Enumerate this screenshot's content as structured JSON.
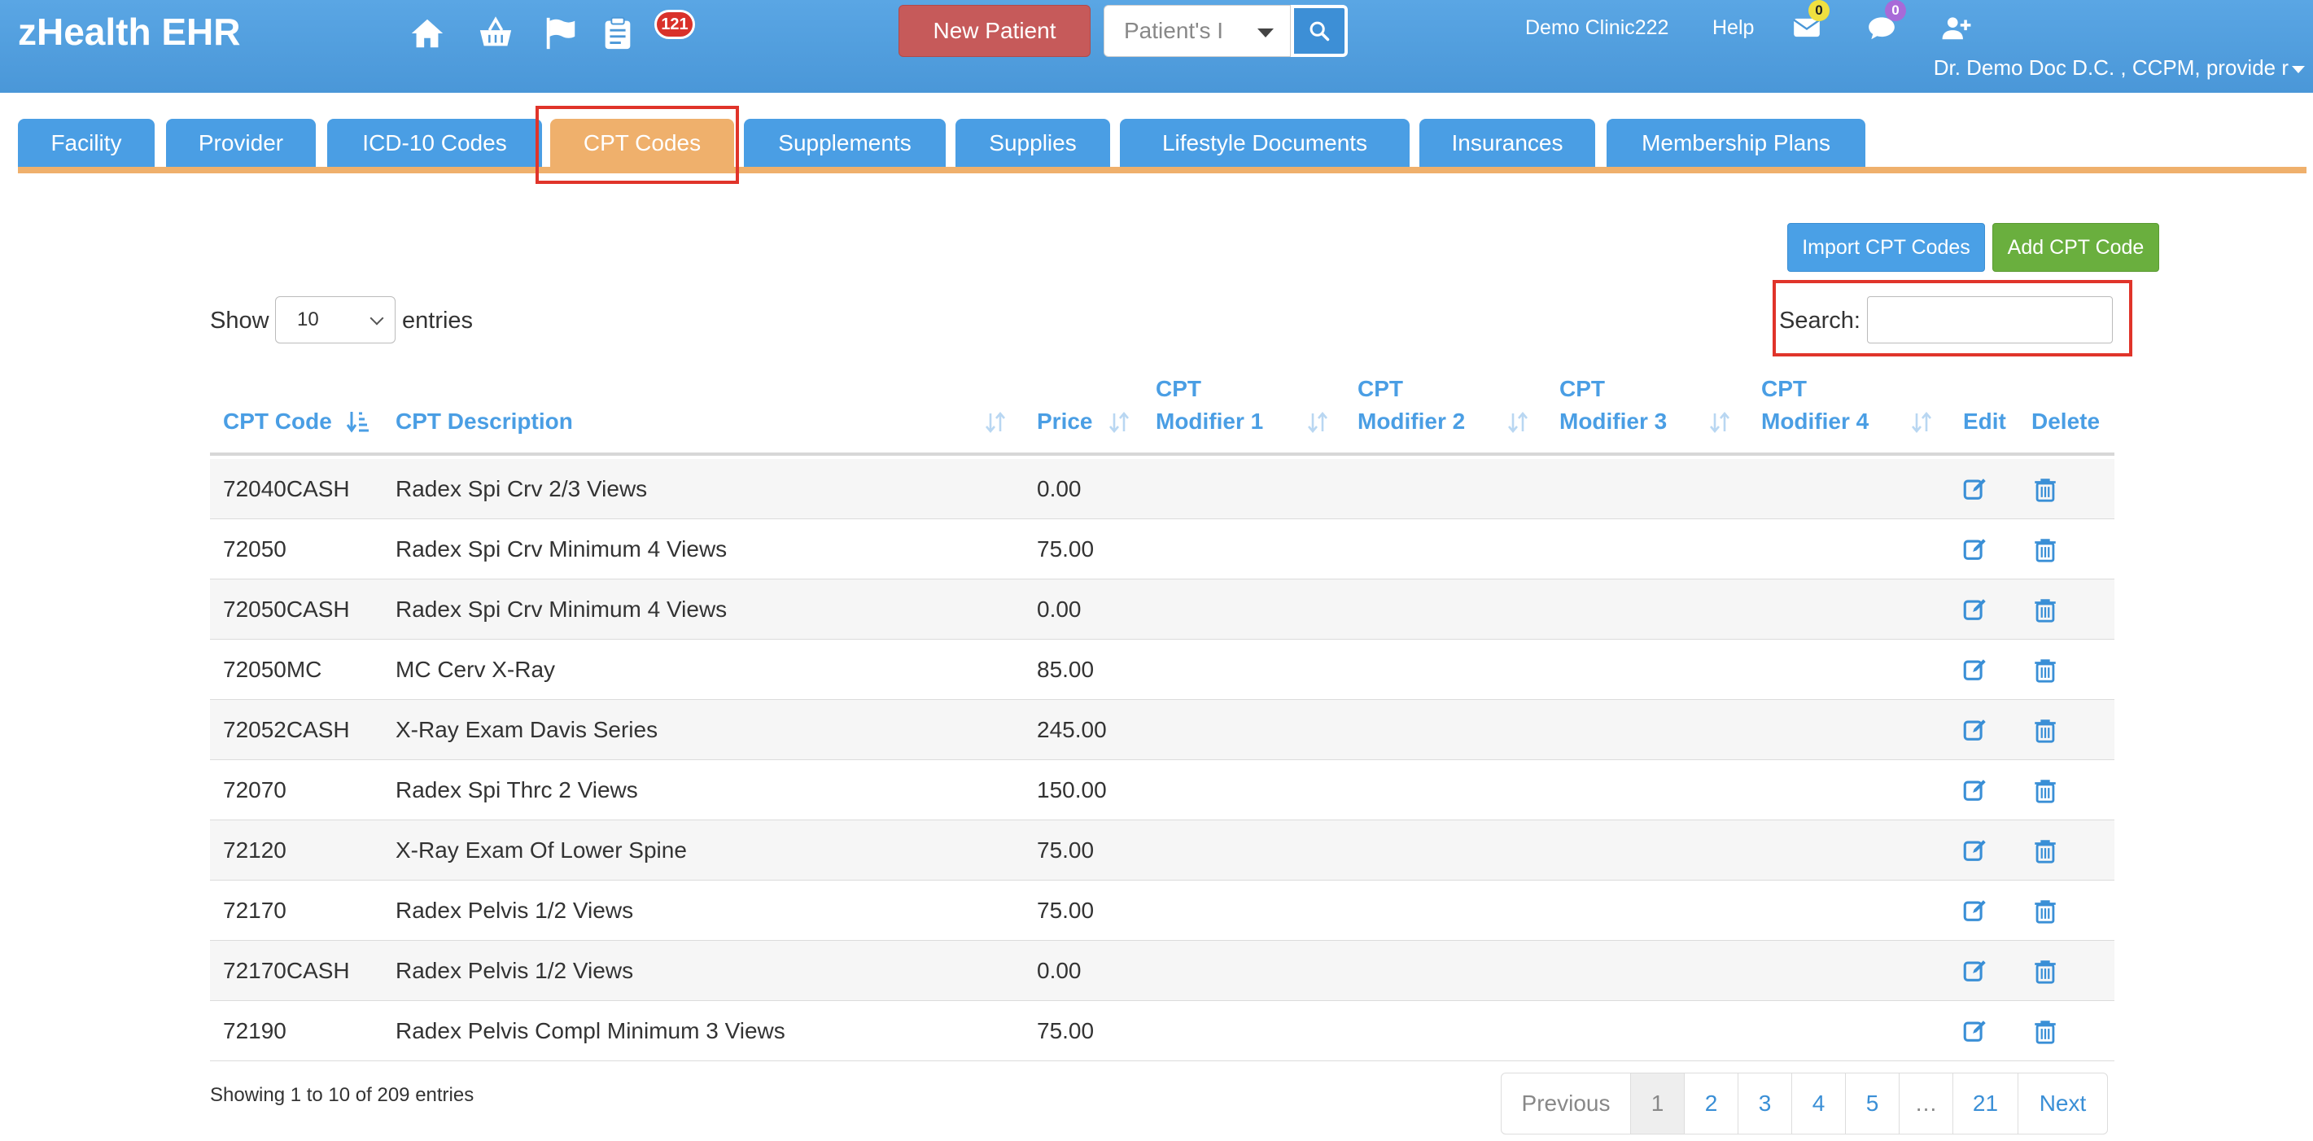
{
  "app": {
    "title": "zHealth EHR",
    "alert_count": "121",
    "new_patient_label": "New Patient",
    "patient_search_placeholder": "Patient's I",
    "clinic_name": "Demo Clinic222",
    "help_label": "Help",
    "mail_count": "0",
    "chat_count": "0",
    "user_name": "Dr. Demo Doc D.C. , CCPM, provide r"
  },
  "tabs": [
    {
      "label": "Facility"
    },
    {
      "label": "Provider"
    },
    {
      "label": "ICD-10 Codes"
    },
    {
      "label": "CPT Codes"
    },
    {
      "label": "Supplements"
    },
    {
      "label": "Supplies"
    },
    {
      "label": "Lifestyle Documents"
    },
    {
      "label": "Insurances"
    },
    {
      "label": "Membership Plans"
    }
  ],
  "toolbar": {
    "import_label": "Import CPT Codes",
    "add_label": "Add CPT Code",
    "show_label": "Show",
    "entries_value": "10",
    "entries_label": "entries",
    "search_label": "Search:",
    "search_value": ""
  },
  "table": {
    "headers": {
      "code": "CPT Code",
      "description": "CPT Description",
      "price": "Price",
      "mod1_a": "CPT",
      "mod1_b": "Modifier 1",
      "mod2_a": "CPT",
      "mod2_b": "Modifier 2",
      "mod3_a": "CPT",
      "mod3_b": "Modifier 3",
      "mod4_a": "CPT",
      "mod4_b": "Modifier 4",
      "edit": "Edit",
      "delete": "Delete"
    },
    "rows": [
      {
        "code": "72040CASH",
        "description": "Radex Spi Crv 2/3 Views",
        "price": "0.00"
      },
      {
        "code": "72050",
        "description": "Radex Spi Crv Minimum 4 Views",
        "price": "75.00"
      },
      {
        "code": "72050CASH",
        "description": "Radex Spi Crv Minimum 4 Views",
        "price": "0.00"
      },
      {
        "code": "72050MC",
        "description": "MC Cerv X-Ray",
        "price": "85.00"
      },
      {
        "code": "72052CASH",
        "description": "X-Ray Exam Davis Series",
        "price": "245.00"
      },
      {
        "code": "72070",
        "description": "Radex Spi Thrc 2 Views",
        "price": "150.00"
      },
      {
        "code": "72120",
        "description": "X-Ray Exam Of Lower Spine",
        "price": "75.00"
      },
      {
        "code": "72170",
        "description": "Radex Pelvis 1/2 Views",
        "price": "75.00"
      },
      {
        "code": "72170CASH",
        "description": "Radex Pelvis 1/2 Views",
        "price": "0.00"
      },
      {
        "code": "72190",
        "description": "Radex Pelvis Compl Minimum 3 Views",
        "price": "75.00"
      }
    ]
  },
  "footer": {
    "info": "Showing 1 to 10 of 209 entries",
    "pages": [
      "Previous",
      "1",
      "2",
      "3",
      "4",
      "5",
      "…",
      "21",
      "Next"
    ]
  },
  "colors": {
    "header_blue": "#4a97d8",
    "tab_blue": "#4a9ee4",
    "tab_active": "#efb06c",
    "link_blue": "#4a9ee4",
    "highlight_red": "#e0342a",
    "new_patient_red": "#c65a5a",
    "add_green": "#6aaf3e"
  },
  "icons": [
    "home-icon",
    "basket-icon",
    "flag-icon",
    "clipboard-icon",
    "search-icon",
    "mail-icon",
    "chat-icon",
    "add-user-icon",
    "edit-icon",
    "trash-icon",
    "sort-icon"
  ]
}
